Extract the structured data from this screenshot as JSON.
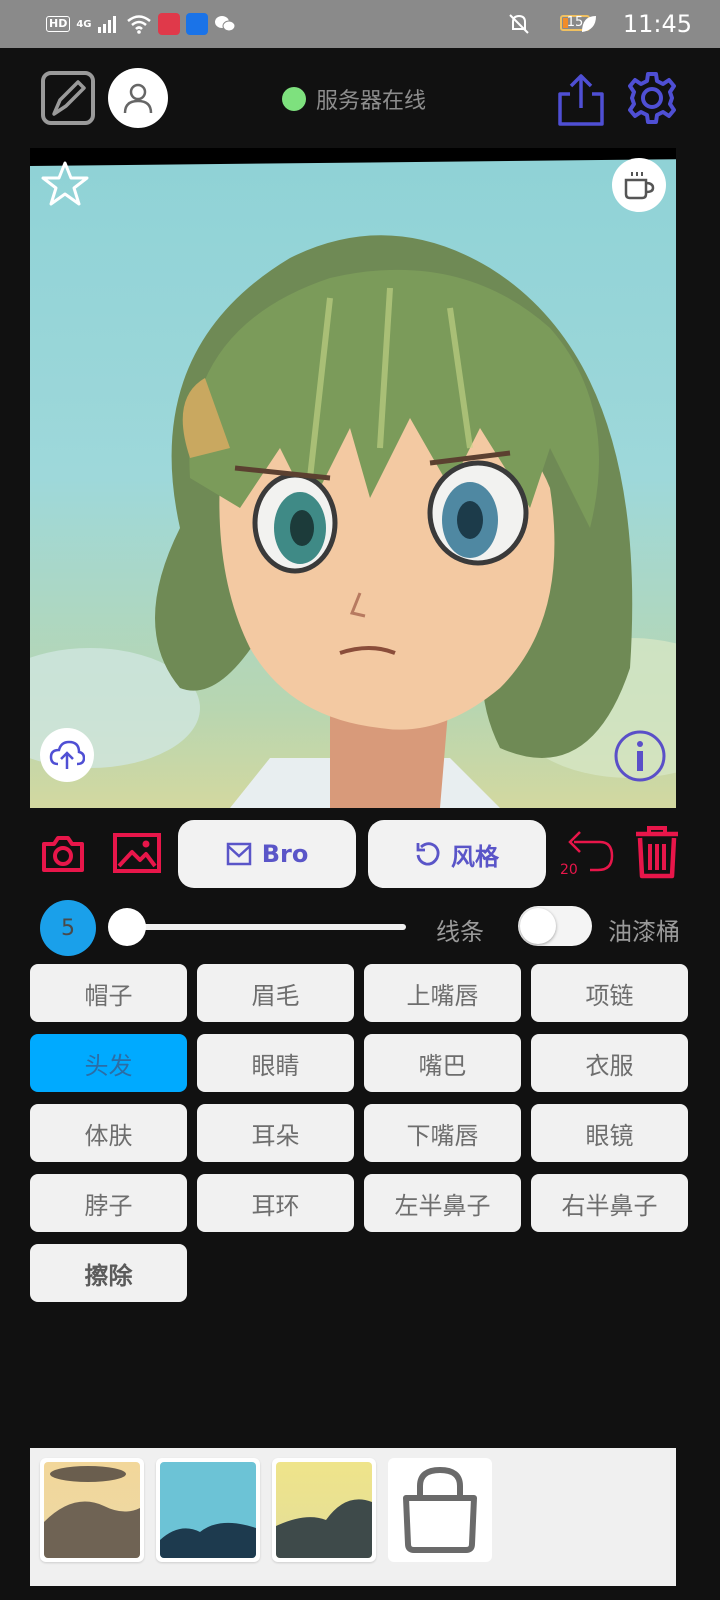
{
  "status_bar": {
    "hd": "HD",
    "network": "4G",
    "battery": "15",
    "time": "11:45",
    "icons": [
      "hd-icon",
      "signal-icon",
      "wifi-icon",
      "huawei-app-icon",
      "bulb-app-icon",
      "wechat-icon",
      "mute-bell-icon",
      "battery-icon",
      "leaf-icon"
    ]
  },
  "header": {
    "server_status": "服务器在线",
    "server_status_color": "#7ee17e",
    "icons": [
      "draw-icon",
      "user-icon",
      "share-icon",
      "gear-icon"
    ]
  },
  "canvas": {
    "icons": [
      "star-icon",
      "coffee-icon",
      "upload-cloud-icon",
      "info-icon"
    ]
  },
  "actions": {
    "bro_label": "Bro",
    "style_label": "风格",
    "undo_count": "20",
    "accent": "#e8164a",
    "button_text_color": "#5a55c8",
    "icons": [
      "camera-icon",
      "image-icon",
      "mail-icon",
      "refresh-icon",
      "undo-icon",
      "trash-icon"
    ]
  },
  "brush": {
    "size": "5",
    "slider_value": 0,
    "line_label": "线条",
    "bucket_label": "油漆桶",
    "bucket_enabled": false
  },
  "parts": [
    {
      "label": "帽子"
    },
    {
      "label": "眉毛"
    },
    {
      "label": "上嘴唇"
    },
    {
      "label": "项链"
    },
    {
      "label": "头发",
      "active": true
    },
    {
      "label": "眼睛"
    },
    {
      "label": "嘴巴"
    },
    {
      "label": "衣服"
    },
    {
      "label": "体肤"
    },
    {
      "label": "耳朵"
    },
    {
      "label": "下嘴唇"
    },
    {
      "label": "眼镜"
    },
    {
      "label": "脖子"
    },
    {
      "label": "耳环"
    },
    {
      "label": "左半鼻子"
    },
    {
      "label": "右半鼻子"
    },
    {
      "label": "擦除",
      "bold": true
    }
  ],
  "tray": {
    "swatches": [
      "style-swatch-1",
      "style-swatch-2",
      "style-swatch-3"
    ],
    "icons": [
      "shopping-bag-icon"
    ]
  }
}
